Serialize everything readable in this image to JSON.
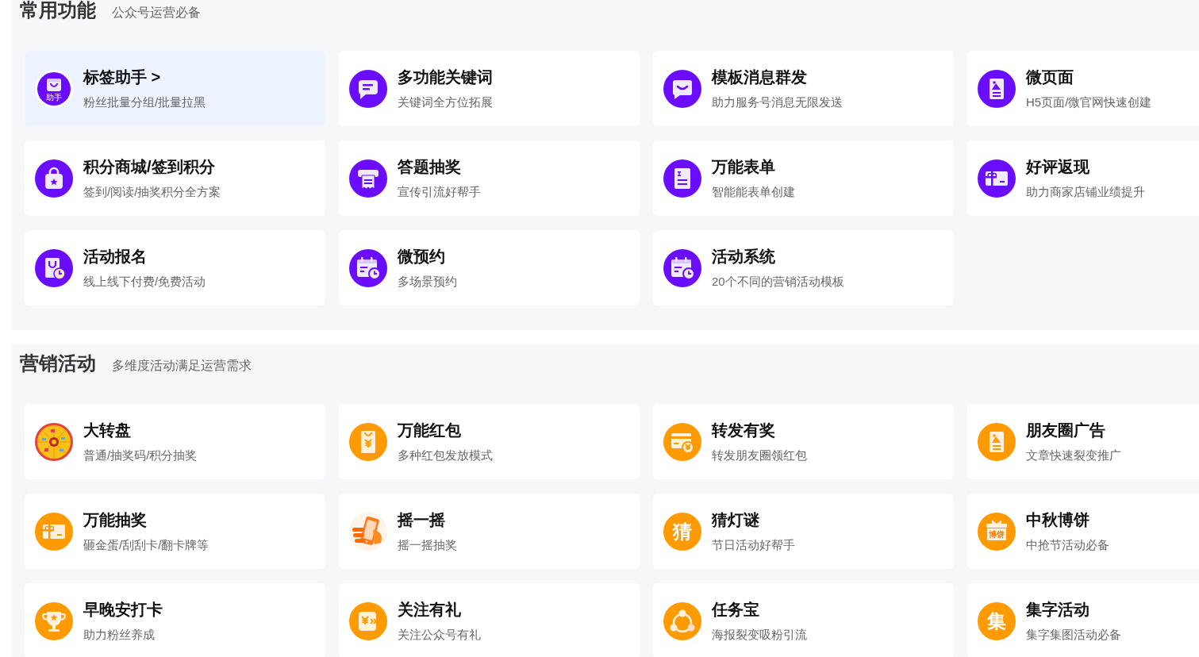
{
  "sections": [
    {
      "title": "常用功能",
      "subtitle": "公众号运营必备",
      "items": [
        {
          "title": "标签助手 >",
          "subtitle": "粉丝批量分组/批量拉黑",
          "selected": true,
          "icon_text": "助手"
        },
        {
          "title": "多功能关键词",
          "subtitle": "关键词全方位拓展",
          "selected": false
        },
        {
          "title": "模板消息群发",
          "subtitle": "助力服务号消息无限发送",
          "selected": false
        },
        {
          "title": "微页面",
          "subtitle": "H5页面/微官网快速创建",
          "selected": false
        },
        {
          "title": "积分商城/签到积分",
          "subtitle": "签到/阅读/抽奖积分全方案",
          "selected": false
        },
        {
          "title": "答题抽奖",
          "subtitle": "宣传引流好帮手",
          "selected": false
        },
        {
          "title": "万能表单",
          "subtitle": "智能能表单创建",
          "selected": false
        },
        {
          "title": "好评返现",
          "subtitle": "助力商家店铺业绩提升",
          "selected": false
        },
        {
          "title": "活动报名",
          "subtitle": "线上线下付费/免费活动",
          "selected": false
        },
        {
          "title": "微预约",
          "subtitle": "多场景预约",
          "selected": false
        },
        {
          "title": "活动系统",
          "subtitle": "20个不同的营销活动模板",
          "selected": false
        }
      ]
    },
    {
      "title": "营销活动",
      "subtitle": "多维度活动满足运营需求",
      "items": [
        {
          "title": "大转盘",
          "subtitle": "普通/抽奖码/积分抽奖",
          "selected": false
        },
        {
          "title": "万能红包",
          "subtitle": "多种红包发放模式",
          "selected": false
        },
        {
          "title": "转发有奖",
          "subtitle": "转发朋友圈领红包",
          "selected": false
        },
        {
          "title": "朋友圈广告",
          "subtitle": "文章快速裂变推广",
          "selected": false
        },
        {
          "title": "万能抽奖",
          "subtitle": "砸金蛋/刮刮卡/翻卡牌等",
          "selected": false
        },
        {
          "title": "摇一摇",
          "subtitle": "摇一摇抽奖",
          "selected": false
        },
        {
          "title": "猜灯谜",
          "subtitle": "节日活动好帮手",
          "selected": false,
          "icon_text": "猜"
        },
        {
          "title": "中秋博饼",
          "subtitle": "中抢节活动必备",
          "selected": false,
          "icon_text": "博饼"
        },
        {
          "title": "早晚安打卡",
          "subtitle": "助力粉丝养成",
          "selected": false
        },
        {
          "title": "关注有礼",
          "subtitle": "关注公众号有礼",
          "selected": false
        },
        {
          "title": "任务宝",
          "subtitle": "海报裂变吸粉引流",
          "selected": false
        },
        {
          "title": "集字活动",
          "subtitle": "集字集图活动必备",
          "selected": false,
          "icon_text": "集"
        }
      ]
    }
  ]
}
